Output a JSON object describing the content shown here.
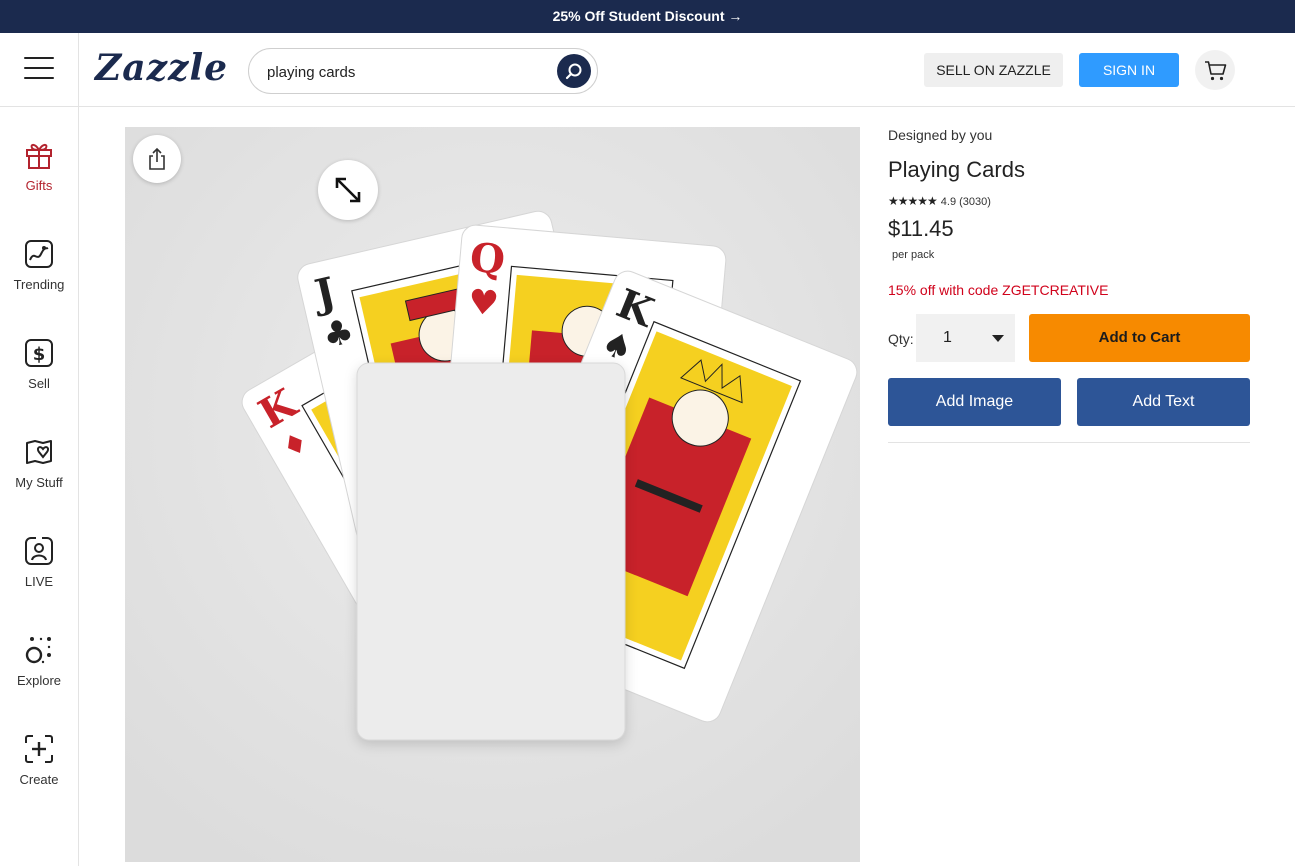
{
  "promo_banner": "25% Off Student Discount →",
  "header": {
    "logo": "Zazzle",
    "search_value": "playing cards",
    "sell_label": "SELL ON ZAZZLE",
    "signin_label": "SIGN IN"
  },
  "sidebar": {
    "items": [
      {
        "label": "Gifts",
        "icon": "gift-icon"
      },
      {
        "label": "Trending",
        "icon": "trending-icon"
      },
      {
        "label": "Sell",
        "icon": "dollar-icon"
      },
      {
        "label": "My Stuff",
        "icon": "my-stuff-icon"
      },
      {
        "label": "LIVE",
        "icon": "live-icon"
      },
      {
        "label": "Explore",
        "icon": "explore-icon"
      },
      {
        "label": "Create",
        "icon": "create-icon"
      }
    ]
  },
  "product": {
    "designed_by": "Designed by you",
    "title": "Playing Cards",
    "stars": "★★★★★",
    "rating": "4.9 (3030)",
    "price": "$11.45",
    "per_unit": "per pack",
    "promo": "15% off with code ZGETCREATIVE",
    "qty_label": "Qty:",
    "qty_value": "1",
    "add_to_cart": "Add to Cart",
    "add_image": "Add Image",
    "add_text": "Add Text",
    "cards": [
      {
        "rank": "K",
        "suit": "♦"
      },
      {
        "rank": "J",
        "suit": "♣"
      },
      {
        "rank": "Q",
        "suit": "♥"
      },
      {
        "rank": "K",
        "suit": "♠"
      }
    ]
  },
  "colors": {
    "brand_navy": "#1b2a4e",
    "signin_blue": "#2f9bff",
    "add_to_cart_orange": "#f78a00",
    "action_blue": "#2d5597",
    "promo_red": "#d0021b",
    "gifts_red": "#b3232e"
  }
}
